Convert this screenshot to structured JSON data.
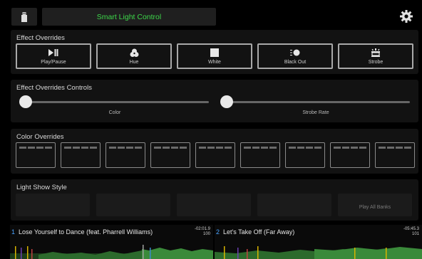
{
  "header": {
    "title": "Smart Light Control",
    "usb_icon": "usb-stick-icon",
    "settings_icon": "gear-icon",
    "accent_color": "#3dd84a"
  },
  "effect_overrides": {
    "title": "Effect Overrides",
    "buttons": [
      {
        "label": "Play/Pause",
        "icon": "play-pause-icon"
      },
      {
        "label": "Hue",
        "icon": "hue-icon"
      },
      {
        "label": "White",
        "icon": "white-square-icon"
      },
      {
        "label": "Black Out",
        "icon": "black-out-icon"
      },
      {
        "label": "Strobe",
        "icon": "strobe-icon"
      }
    ]
  },
  "controls": {
    "title": "Effect Overrides Controls",
    "sliders": [
      {
        "label": "Color",
        "value": 0
      },
      {
        "label": "Strobe Rate",
        "value": 0
      }
    ]
  },
  "color_overrides": {
    "title": "Color Overrides",
    "count": 9
  },
  "light_show": {
    "title": "Light Show Style",
    "buttons": [
      "",
      "",
      "",
      "",
      "Play All Banks"
    ]
  },
  "decks": [
    {
      "number": "1",
      "title": "Lose Yourself to Dance (feat. Pharrell Williams)",
      "time": "-02:01.9",
      "bpm": "100"
    },
    {
      "number": "2",
      "title": "Let's Take Off (Far Away)",
      "time": "-05:45.3",
      "bpm": "101"
    }
  ]
}
